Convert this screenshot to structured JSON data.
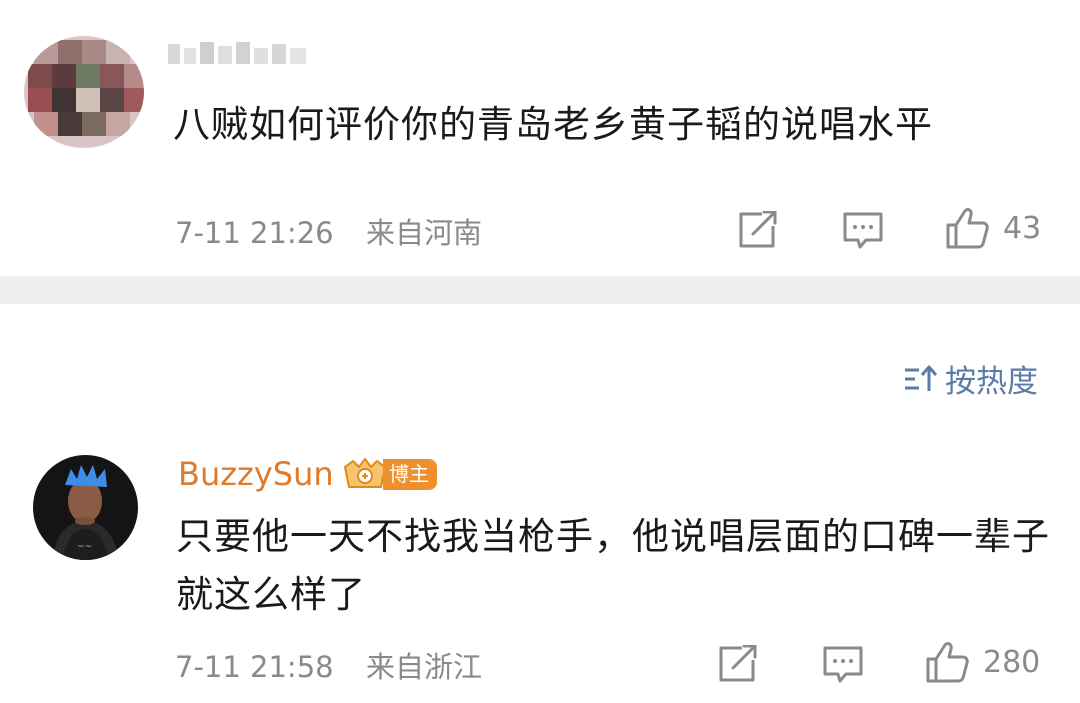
{
  "comments": [
    {
      "username": "",
      "text": "八贼如何评价你的青岛老乡黄子韬的说唱水平",
      "time": "7-11 21:26",
      "location": "来自河南",
      "like_count": "43"
    },
    {
      "username": "BuzzySun",
      "badge": "博主",
      "text": "只要他一天不找我当枪手，他说唱层面的口碑一辈子就这么样了",
      "time": "7-11 21:58",
      "location": "来自浙江",
      "like_count": "280"
    }
  ],
  "sort": {
    "label": "按热度"
  },
  "colors": {
    "username_accent": "#e07b2c",
    "badge_bg": "#f0902c",
    "sort_link": "#5b7aa6",
    "meta_text": "#8a8a8a",
    "separator": "#efefef"
  },
  "icons": [
    "share-icon",
    "comment-icon",
    "like-icon",
    "sort-icon",
    "vip-crown-icon"
  ]
}
